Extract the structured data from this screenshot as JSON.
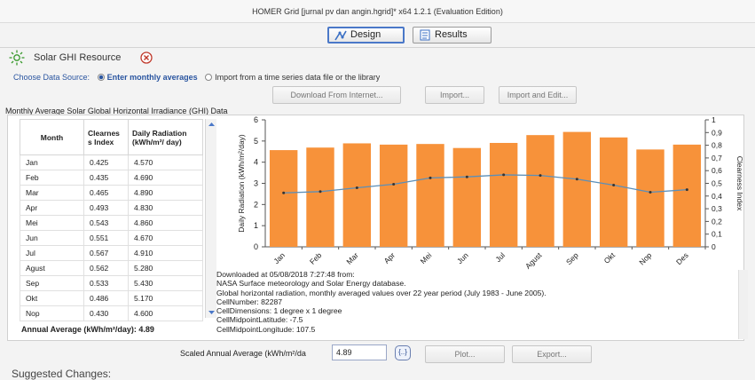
{
  "window": {
    "title": "HOMER Grid [jurnal pv dan angin.hgrid]* x64 1.2.1 (Evaluation Edition)"
  },
  "tabs": [
    {
      "label": "Design",
      "icon": "design-icon",
      "active": true
    },
    {
      "label": "Results",
      "icon": "results-icon",
      "active": false
    }
  ],
  "resource": {
    "title": "Solar GHI Resource",
    "icon": "sun-icon",
    "close_icon": "close-circle-icon",
    "accent": "#3a9a2e"
  },
  "data_source": {
    "label": "Choose Data Source:",
    "option_monthly": "Enter monthly averages",
    "option_import": "Import from a time series data file or the library",
    "selected": "monthly"
  },
  "buttons": {
    "download": "Download From Internet...",
    "import": "Import...",
    "import_edit": "Import and Edit...",
    "plot": "Plot...",
    "export": "Export..."
  },
  "section_label": "Monthly Average Solar Global Horizontal Irradiance (GHI) Data",
  "table": {
    "headers": [
      "Month",
      "Clearnes s Index",
      "Daily Radiation (kWh/m²/ day)"
    ],
    "rows": [
      [
        "Jan",
        "0.425",
        "4.570"
      ],
      [
        "Feb",
        "0.435",
        "4.690"
      ],
      [
        "Mar",
        "0.465",
        "4.890"
      ],
      [
        "Apr",
        "0.493",
        "4.830"
      ],
      [
        "Mei",
        "0.543",
        "4.860"
      ],
      [
        "Jun",
        "0.551",
        "4.670"
      ],
      [
        "Jul",
        "0.567",
        "4.910"
      ],
      [
        "Agust",
        "0.562",
        "5.280"
      ],
      [
        "Sep",
        "0.533",
        "5.430"
      ],
      [
        "Okt",
        "0.486",
        "5.170"
      ],
      [
        "Nop",
        "0.430",
        "4.600"
      ]
    ]
  },
  "annual_average": "Annual Average (kWh/m²/day): 4.89",
  "chart_data": {
    "type": "bar",
    "categories": [
      "Jan",
      "Feb",
      "Mar",
      "Apr",
      "Mei",
      "Jun",
      "Jul",
      "Agust",
      "Sep",
      "Okt",
      "Nop",
      "Des"
    ],
    "series": [
      {
        "name": "Daily Radiation",
        "type": "bar",
        "axis": "left",
        "color": "#f7923a",
        "values": [
          4.57,
          4.69,
          4.89,
          4.83,
          4.86,
          4.67,
          4.91,
          5.28,
          5.43,
          5.17,
          4.6,
          4.83
        ]
      },
      {
        "name": "Clearness Index",
        "type": "line",
        "axis": "right",
        "color": "#5b8fb9",
        "values": [
          0.425,
          0.435,
          0.465,
          0.493,
          0.543,
          0.551,
          0.567,
          0.562,
          0.533,
          0.486,
          0.43,
          0.45
        ]
      }
    ],
    "ylabel": "Daily Radiation (kWh/m²/day)",
    "y2label": "Clearness Index",
    "ylim": [
      0,
      6
    ],
    "yticks": [
      "0",
      "1",
      "2",
      "3",
      "4",
      "5",
      "6"
    ],
    "y2lim": [
      0,
      1
    ],
    "y2ticks": [
      "0",
      "0,1",
      "0,2",
      "0,3",
      "0,4",
      "0,5",
      "0,6",
      "0,7",
      "0,8",
      "0,9",
      "1"
    ],
    "grid": false
  },
  "info_lines": [
    "Downloaded at 05/08/2018 7:27:48 from:",
    "NASA Surface meteorology and Solar Energy database.",
    "Global horizontal radiation, monthly averaged values over 22 year period (July 1983 - June 2005).",
    "CellNumber: 82287",
    "CellDimensions: 1 degree x 1 degree",
    "CellMidpointLatitude: -7.5",
    "CellMidpointLongitude: 107.5"
  ],
  "scaled": {
    "label": "Scaled Annual Average (kWh/m²/da",
    "value": "4.89",
    "icon": "sensitivity-icon"
  },
  "suggested_changes": "Suggested Changes:"
}
